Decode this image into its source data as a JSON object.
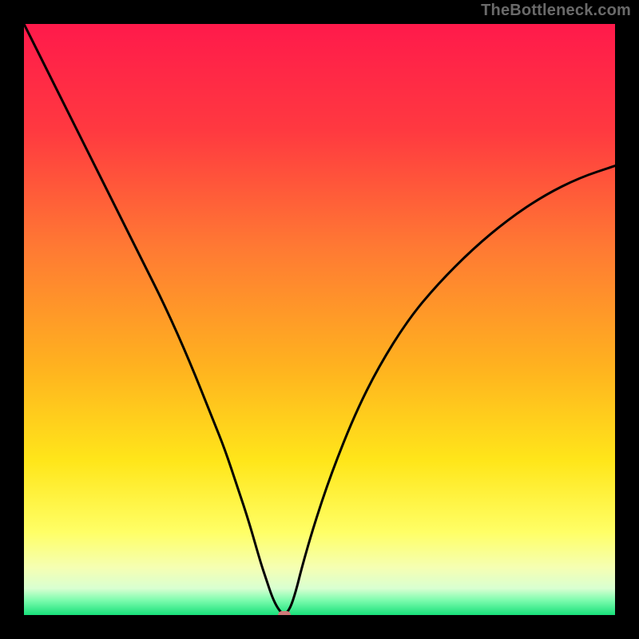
{
  "watermark": "TheBottleneck.com",
  "colors": {
    "frame": "#000000",
    "watermark": "#6a6a6a",
    "curve": "#000000",
    "marker": "#cf7a79",
    "gradient_stops": [
      {
        "offset": 0,
        "color": "#ff1a4b"
      },
      {
        "offset": 0.18,
        "color": "#ff3940"
      },
      {
        "offset": 0.38,
        "color": "#ff7a33"
      },
      {
        "offset": 0.58,
        "color": "#ffb21f"
      },
      {
        "offset": 0.74,
        "color": "#ffe61a"
      },
      {
        "offset": 0.86,
        "color": "#ffff66"
      },
      {
        "offset": 0.92,
        "color": "#f5ffb3"
      },
      {
        "offset": 0.955,
        "color": "#d9ffd1"
      },
      {
        "offset": 0.975,
        "color": "#7dfcae"
      },
      {
        "offset": 1.0,
        "color": "#18e07a"
      }
    ]
  },
  "chart_data": {
    "type": "line",
    "title": "",
    "xlabel": "",
    "ylabel": "",
    "xlim": [
      0,
      100
    ],
    "ylim": [
      0,
      100
    ],
    "grid": false,
    "legend": false,
    "notch_x": 44,
    "marker": {
      "x": 44,
      "y": 0
    },
    "series": [
      {
        "name": "bottleneck-curve",
        "x": [
          0,
          4,
          8,
          12,
          16,
          20,
          24,
          28,
          32,
          34,
          36,
          38,
          40,
          41,
          42,
          43,
          44,
          45,
          46,
          47,
          49,
          52,
          56,
          60,
          65,
          70,
          76,
          82,
          88,
          94,
          100
        ],
        "y": [
          100,
          92,
          84,
          76,
          68,
          60,
          52,
          43,
          33,
          28,
          22,
          16,
          9,
          6,
          3,
          1,
          0,
          1,
          4,
          8,
          15,
          24,
          34,
          42,
          50,
          56,
          62,
          67,
          71,
          74,
          76
        ]
      }
    ]
  }
}
